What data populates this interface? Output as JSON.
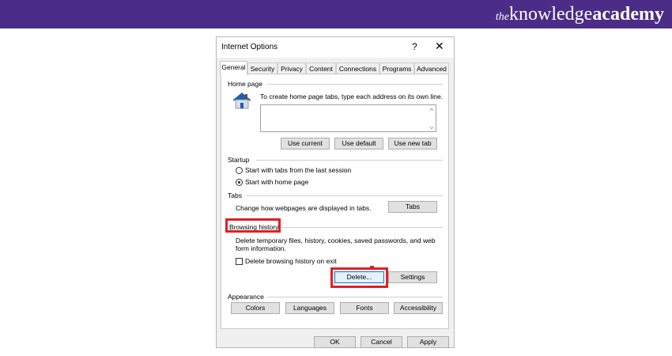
{
  "brand": {
    "the": "the",
    "knowledge": "knowledge",
    "academy": "academy"
  },
  "dialog": {
    "title": "Internet Options",
    "help_glyph": "?",
    "close_glyph": "✕",
    "tabs": [
      "General",
      "Security",
      "Privacy",
      "Content",
      "Connections",
      "Programs",
      "Advanced"
    ],
    "home_page": {
      "label": "Home page",
      "description": "To create home page tabs, type each address on its own line.",
      "value": "",
      "buttons": [
        "Use current",
        "Use default",
        "Use new tab"
      ]
    },
    "startup": {
      "label": "Startup",
      "options": [
        "Start with tabs from the last session",
        "Start with home page"
      ],
      "selected": "Start with home page"
    },
    "tabs_group": {
      "label": "Tabs",
      "description": "Change how webpages are displayed in tabs.",
      "button": "Tabs"
    },
    "browsing_history": {
      "label": "Browsing history",
      "description_line1": "Delete temporary files, history, cookies, saved passwords, and web",
      "description_line2": "form information.",
      "checkbox_label": "Delete browsing history on exit",
      "checkbox_checked": false,
      "delete_button": "Delete...",
      "settings_button": "Settings"
    },
    "appearance": {
      "label": "Appearance",
      "buttons": [
        "Colors",
        "Languages",
        "Fonts",
        "Accessibility"
      ]
    },
    "footer": {
      "ok": "OK",
      "cancel": "Cancel",
      "apply": "Apply"
    }
  },
  "colors": {
    "banner": "#4b2d87",
    "highlight": "#e01f26"
  }
}
